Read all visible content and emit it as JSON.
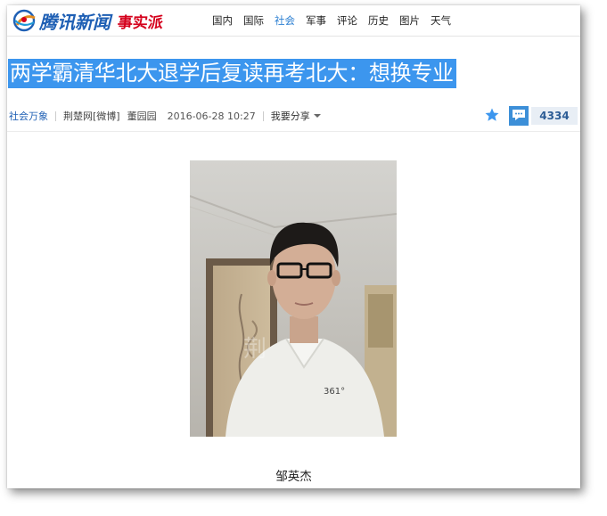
{
  "header": {
    "logo_text": "腾讯新闻",
    "sub_logo": "事实派",
    "nav": [
      {
        "label": "国内",
        "active": false
      },
      {
        "label": "国际",
        "active": false
      },
      {
        "label": "社会",
        "active": true
      },
      {
        "label": "军事",
        "active": false
      },
      {
        "label": "评论",
        "active": false
      },
      {
        "label": "历史",
        "active": false
      },
      {
        "label": "图片",
        "active": false
      },
      {
        "label": "天气",
        "active": false
      }
    ]
  },
  "article": {
    "title": "两学霸清华北大退学后复读再考北大：想换专业",
    "category": "社会万象",
    "source": "荆楚网[微博]",
    "author": "董园园",
    "datetime": "2016-06-28  10:27",
    "share_label": "我要分享",
    "comment_count": "4334",
    "photo_caption": "邹英杰"
  },
  "colors": {
    "accent_blue": "#2b7fd2",
    "headline_highlight": "#3c96ee",
    "brand_red": "#d5001c"
  },
  "icons": {
    "favorite": "star-icon",
    "comment": "comment-icon",
    "share_dropdown": "caret-down-icon"
  }
}
